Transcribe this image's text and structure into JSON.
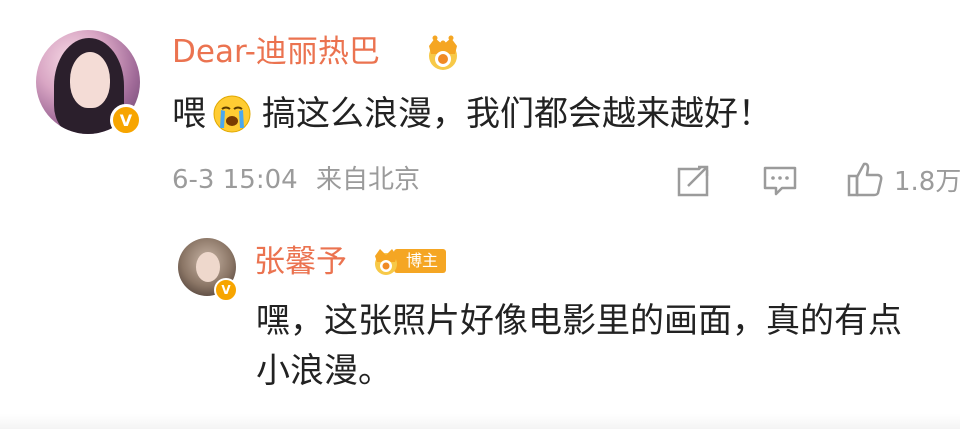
{
  "comment": {
    "username": "Dear-迪丽热巴",
    "text_before_emoji": "喂",
    "emoji": "crying-face",
    "text_after_emoji": "搞这么浪漫，我们都会越来越好！",
    "timestamp": "6-3 15:04",
    "location": "来自北京",
    "like_count": "1.8万",
    "verified_badge": "V"
  },
  "reply": {
    "username": "张馨予",
    "badge_label": "博主",
    "text_lines": [
      "嘿，这张照片好像电影里的画面，真的有点",
      "小浪漫。"
    ],
    "verified_badge": "V"
  },
  "colors": {
    "username": "#eb7350",
    "meta": "#9b9b9b",
    "verified": "#f7a500",
    "badge": "#f5a623"
  }
}
